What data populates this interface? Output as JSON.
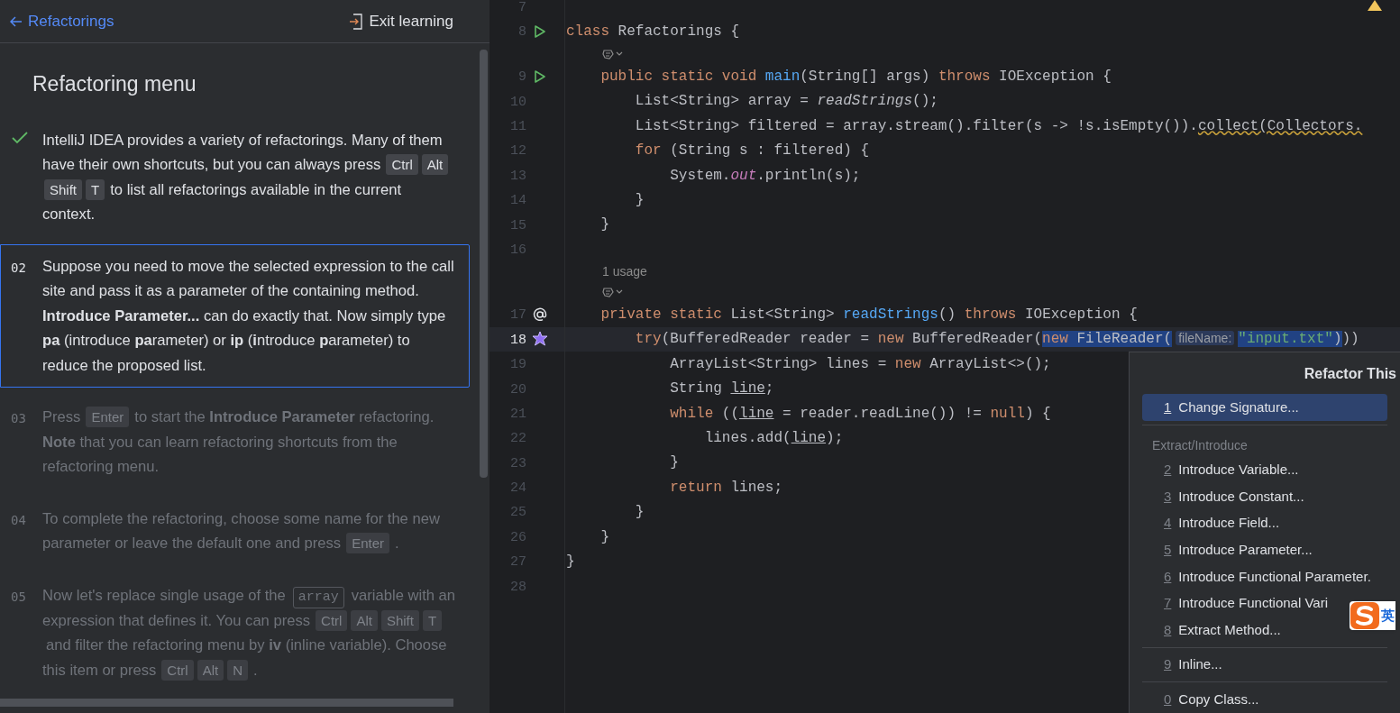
{
  "header": {
    "back_link": "Refactorings",
    "exit_button": "Exit learning"
  },
  "lesson": {
    "title": "Refactoring menu",
    "steps": [
      {
        "done": true,
        "selected": false,
        "parts": [
          {
            "kind": "text",
            "text": "IntelliJ IDEA provides a variety of refactorings. Many of them have their own shortcuts, but you can always press"
          },
          {
            "kind": "key",
            "text": "Ctrl"
          },
          {
            "kind": "key",
            "text": "Alt"
          },
          {
            "kind": "key",
            "text": "Shift"
          },
          {
            "kind": "key",
            "text": "T"
          },
          {
            "kind": "text",
            "text": "to list all refactorings available in the current context."
          }
        ]
      },
      {
        "number": "02",
        "done": false,
        "selected": true,
        "parts": [
          {
            "kind": "text",
            "text": "Suppose you need to move the selected expression to the call site and pass it as a parameter of the containing method. **Introduce Parameter...** can do exactly that. Now simply type **pa** (introduce **pa**rameter) or **ip** (**i**ntroduce **p**arameter) to reduce the proposed list."
          }
        ]
      },
      {
        "number": "03",
        "done": false,
        "selected": false,
        "parts": [
          {
            "kind": "text",
            "text": "Press"
          },
          {
            "kind": "key",
            "text": "Enter"
          },
          {
            "kind": "text",
            "text": "to start the **Introduce Parameter** refactoring. **Note** that you can learn refactoring shortcuts from the refactoring menu."
          }
        ]
      },
      {
        "number": "04",
        "done": false,
        "selected": false,
        "parts": [
          {
            "kind": "text",
            "text": "To complete the refactoring, choose some name for the new parameter or leave the default one and press"
          },
          {
            "kind": "key",
            "text": "Enter"
          },
          {
            "kind": "text",
            "text": "."
          }
        ]
      },
      {
        "number": "05",
        "done": false,
        "selected": false,
        "parts": [
          {
            "kind": "text",
            "text": "Now let's replace single usage of the"
          },
          {
            "kind": "code",
            "text": "array"
          },
          {
            "kind": "text",
            "text": "variable with an expression that defines it. You can press"
          },
          {
            "kind": "key",
            "text": "Ctrl"
          },
          {
            "kind": "key",
            "text": "Alt"
          },
          {
            "kind": "key",
            "text": "Shift"
          },
          {
            "kind": "key",
            "text": "T"
          },
          {
            "kind": "text",
            "text": "and filter the refactoring menu by **iv** (inline variable). Choose this item or press"
          },
          {
            "kind": "key",
            "text": "Ctrl"
          },
          {
            "kind": "key",
            "text": "Alt"
          },
          {
            "kind": "key",
            "text": "N"
          },
          {
            "kind": "text",
            "text": "."
          }
        ]
      }
    ]
  },
  "editor": {
    "rows": [
      {
        "kind": "code",
        "number": "7",
        "current": false,
        "tokens": []
      },
      {
        "kind": "code",
        "number": "8",
        "current": false,
        "gutter": {
          "kind": "run"
        },
        "tokens": [
          {
            "kind": "kw",
            "s": "class "
          },
          {
            "kind": "plain",
            "s": "Refactorings {"
          }
        ]
      },
      {
        "kind": "hint"
      },
      {
        "kind": "code",
        "number": "9",
        "current": false,
        "gutter": {
          "kind": "run"
        },
        "tokens": [
          {
            "kind": "kw",
            "s": "    public static void "
          },
          {
            "kind": "fn",
            "s": "main"
          },
          {
            "kind": "plain",
            "s": "(String[] args) "
          },
          {
            "kind": "kw",
            "s": "throws "
          },
          {
            "kind": "plain",
            "s": "IOException {"
          }
        ]
      },
      {
        "kind": "code",
        "number": "10",
        "current": false,
        "tokens": [
          {
            "kind": "plain",
            "s": "        List<String> array = "
          },
          {
            "kind": "italic",
            "s": "readStrings"
          },
          {
            "kind": "plain",
            "s": "();"
          }
        ]
      },
      {
        "kind": "code",
        "number": "11",
        "current": false,
        "tokens": [
          {
            "kind": "plain",
            "s": "        List<String> filtered = array.stream().filter(s -> !s.isEmpty())."
          },
          {
            "kind": "warn",
            "s": "collect(Collectors."
          }
        ]
      },
      {
        "kind": "code",
        "number": "12",
        "current": false,
        "tokens": [
          {
            "kind": "kw",
            "s": "        for "
          },
          {
            "kind": "plain",
            "s": "(String s : filtered) {"
          }
        ]
      },
      {
        "kind": "code",
        "number": "13",
        "current": false,
        "tokens": [
          {
            "kind": "plain",
            "s": "            System."
          },
          {
            "kind": "field",
            "s": "out"
          },
          {
            "kind": "plain",
            "s": ".println(s);"
          }
        ]
      },
      {
        "kind": "code",
        "number": "14",
        "current": false,
        "tokens": [
          {
            "kind": "plain",
            "s": "        }"
          }
        ]
      },
      {
        "kind": "code",
        "number": "15",
        "current": false,
        "tokens": [
          {
            "kind": "plain",
            "s": "    }"
          }
        ]
      },
      {
        "kind": "code",
        "number": "16",
        "current": false,
        "tokens": []
      },
      {
        "kind": "usage",
        "text": "1 usage"
      },
      {
        "kind": "hint"
      },
      {
        "kind": "code",
        "number": "17",
        "current": false,
        "gutter": {
          "kind": "override"
        },
        "tokens": [
          {
            "kind": "kw",
            "s": "    private static "
          },
          {
            "kind": "plain",
            "s": "List<String> "
          },
          {
            "kind": "fn",
            "s": "readStrings"
          },
          {
            "kind": "plain",
            "s": "() "
          },
          {
            "kind": "kw",
            "s": "throws "
          },
          {
            "kind": "plain",
            "s": "IOException {"
          }
        ]
      },
      {
        "kind": "code",
        "number": "18",
        "current": true,
        "gutter": {
          "kind": "refactor"
        },
        "tokens": [
          {
            "kind": "kw",
            "s": "        try",
            "selected": false
          },
          {
            "kind": "plain",
            "s": "(BufferedReader reader = ",
            "selected": false
          },
          {
            "kind": "kw",
            "s": "new ",
            "selected": false
          },
          {
            "kind": "plain",
            "s": "BufferedReader(",
            "selected": false
          },
          {
            "kind": "kw",
            "s": "new ",
            "selected": true
          },
          {
            "kind": "plain",
            "s": "FileReader(",
            "selected": true
          },
          {
            "kind": "param",
            "s": "fileName:",
            "selected": true
          },
          {
            "kind": "string",
            "s": "\"input.txt\"",
            "selected": true
          },
          {
            "kind": "plain",
            "s": ")",
            "selected": true
          },
          {
            "kind": "plain",
            "s": "))",
            "selected": false
          }
        ]
      },
      {
        "kind": "code",
        "number": "19",
        "current": false,
        "tokens": [
          {
            "kind": "plain",
            "s": "            ArrayList<String> lines = "
          },
          {
            "kind": "kw",
            "s": "new "
          },
          {
            "kind": "plain",
            "s": "ArrayList<>();"
          }
        ]
      },
      {
        "kind": "code",
        "number": "20",
        "current": false,
        "tokens": [
          {
            "kind": "plain",
            "s": "            String "
          },
          {
            "kind": "under",
            "s": "line"
          },
          {
            "kind": "plain",
            "s": ";"
          }
        ]
      },
      {
        "kind": "code",
        "number": "21",
        "current": false,
        "tokens": [
          {
            "kind": "kw",
            "s": "            while "
          },
          {
            "kind": "plain",
            "s": "(("
          },
          {
            "kind": "under",
            "s": "line"
          },
          {
            "kind": "plain",
            "s": " = reader.readLine()) != "
          },
          {
            "kind": "kw",
            "s": "null"
          },
          {
            "kind": "plain",
            "s": ") {"
          }
        ]
      },
      {
        "kind": "code",
        "number": "22",
        "current": false,
        "tokens": [
          {
            "kind": "plain",
            "s": "                lines.add("
          },
          {
            "kind": "under",
            "s": "line"
          },
          {
            "kind": "plain",
            "s": ");"
          }
        ]
      },
      {
        "kind": "code",
        "number": "23",
        "current": false,
        "tokens": [
          {
            "kind": "plain",
            "s": "            }"
          }
        ]
      },
      {
        "kind": "code",
        "number": "24",
        "current": false,
        "tokens": [
          {
            "kind": "kw",
            "s": "            return "
          },
          {
            "kind": "plain",
            "s": "lines;"
          }
        ]
      },
      {
        "kind": "code",
        "number": "25",
        "current": false,
        "tokens": [
          {
            "kind": "plain",
            "s": "        }"
          }
        ]
      },
      {
        "kind": "code",
        "number": "26",
        "current": false,
        "tokens": [
          {
            "kind": "plain",
            "s": "    }"
          }
        ]
      },
      {
        "kind": "code",
        "number": "27",
        "current": false,
        "tokens": [
          {
            "kind": "plain",
            "s": "}"
          }
        ]
      },
      {
        "kind": "code",
        "number": "28",
        "current": false,
        "tokens": []
      }
    ]
  },
  "popup": {
    "title": "Refactor This",
    "items": [
      {
        "kind": "item",
        "key": "1",
        "label": "Change Signature...",
        "selected": true
      },
      {
        "kind": "separator"
      },
      {
        "kind": "header",
        "label": "Extract/Introduce"
      },
      {
        "kind": "item",
        "key": "2",
        "label": "Introduce Variable...",
        "selected": false
      },
      {
        "kind": "item",
        "key": "3",
        "label": "Introduce Constant...",
        "selected": false
      },
      {
        "kind": "item",
        "key": "4",
        "label": "Introduce Field...",
        "selected": false
      },
      {
        "kind": "item",
        "key": "5",
        "label": "Introduce Parameter...",
        "selected": false
      },
      {
        "kind": "item",
        "key": "6",
        "label": "Introduce Functional Parameter.",
        "selected": false
      },
      {
        "kind": "item",
        "key": "7",
        "label": "Introduce Functional Vari",
        "selected": false
      },
      {
        "kind": "item",
        "key": "8",
        "label": "Extract Method...",
        "selected": false
      },
      {
        "kind": "separator"
      },
      {
        "kind": "item",
        "key": "9",
        "label": "Inline...",
        "selected": false
      },
      {
        "kind": "separator"
      },
      {
        "kind": "item",
        "key": "0",
        "label": "Copy Class...",
        "selected": false
      }
    ]
  },
  "ime": {
    "mode": "英"
  }
}
